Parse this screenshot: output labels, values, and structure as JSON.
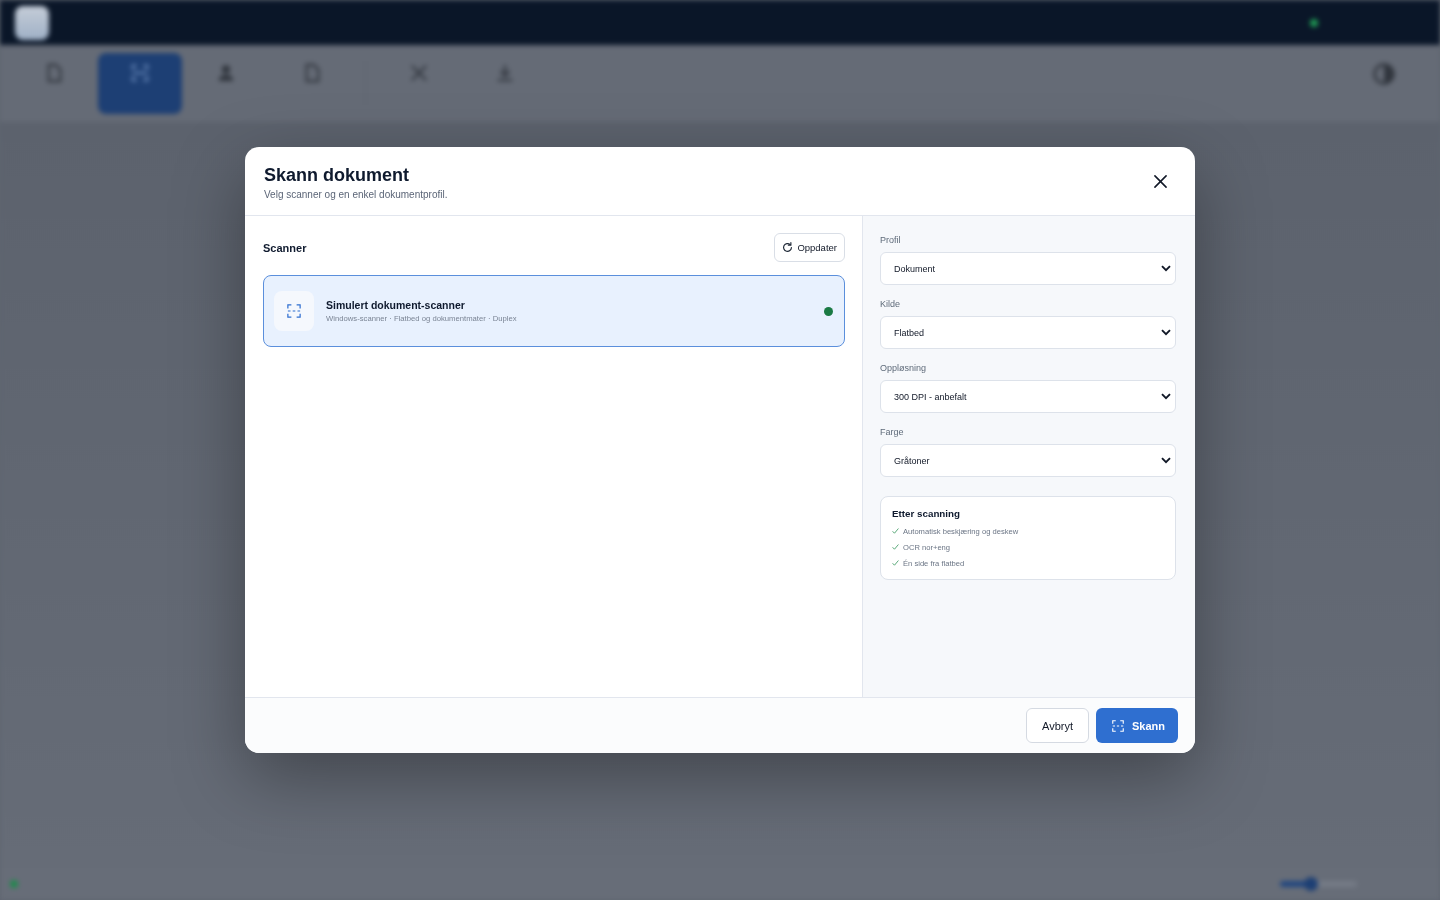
{
  "backdrop": {
    "toolbar": [
      {
        "selected": false
      },
      {
        "selected": true
      },
      {
        "selected": false
      },
      {
        "selected": false
      },
      {
        "selected": false
      },
      {
        "selected": false
      }
    ],
    "zoom_slider": {
      "level": 0.4
    }
  },
  "dialog": {
    "title": "Skann dokument",
    "subtitle": "Velg scanner og en enkel dokumentprofil."
  },
  "scanner_section": {
    "heading": "Scanner",
    "refresh_button": "Oppdater",
    "scanners": [
      {
        "name": "Simulert dokument-scanner",
        "details": "Windows-scanner · Flatbed og dokumentmater · Duplex",
        "selected": true,
        "online": true
      }
    ]
  },
  "settings": [
    {
      "label": "Profil",
      "value": "Dokument"
    },
    {
      "label": "Kilde",
      "value": "Flatbed"
    },
    {
      "label": "Oppløsning",
      "value": "300 DPI - anbefalt"
    },
    {
      "label": "Farge",
      "value": "Gråtoner"
    }
  ],
  "after_scan": {
    "title": "Etter scanning",
    "items": [
      "Automatisk beskjæring og deskew",
      "OCR nor+eng",
      "Én side fra flatbed"
    ]
  },
  "footer": {
    "buttons": [
      {
        "label": "Avbryt",
        "kind": "secondary"
      },
      {
        "label": "Skann",
        "kind": "primary"
      }
    ]
  }
}
